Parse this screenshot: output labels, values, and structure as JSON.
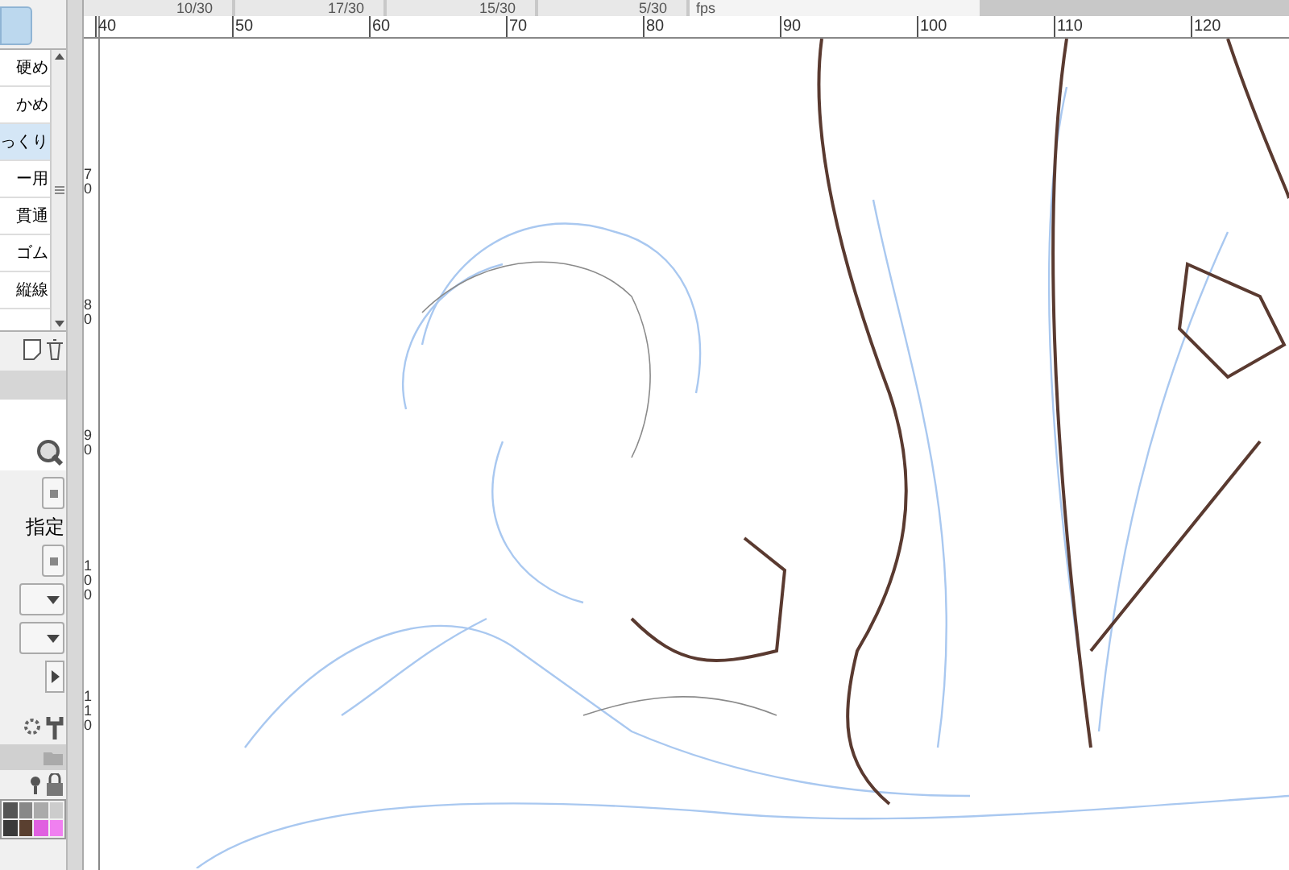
{
  "document_tabs": [
    {
      "label": "10/30",
      "selected": false
    },
    {
      "label": "17/30",
      "selected": false
    },
    {
      "label": "15/30",
      "selected": false
    },
    {
      "label": "5/30",
      "selected": false
    }
  ],
  "frame_rate": {
    "value": "fps"
  },
  "brush_list": {
    "items": [
      {
        "label": "硬め",
        "selected": false
      },
      {
        "label": "かめ",
        "selected": false
      },
      {
        "label": "っくり",
        "selected": true
      },
      {
        "label": "ー用",
        "selected": false
      },
      {
        "label": "貫通",
        "selected": false
      },
      {
        "label": "ゴム",
        "selected": false
      },
      {
        "label": "縦線",
        "selected": false
      }
    ]
  },
  "tool_property": {
    "label": "指定"
  },
  "palette": {
    "swatches": [
      {
        "color": "#555555"
      },
      {
        "color": "#888888"
      },
      {
        "color": "#aaaaaa"
      },
      {
        "color": "#cccccc"
      },
      {
        "color": "#3a3a3a"
      },
      {
        "color": "#5a4030"
      },
      {
        "color": "#e060e0"
      },
      {
        "color": "#f080f0"
      }
    ]
  },
  "ruler": {
    "horizontal": [
      "40",
      "50",
      "60",
      "70",
      "80",
      "90",
      "100",
      "110",
      "120"
    ],
    "vertical": [
      "70",
      "80",
      "90",
      "100",
      "110"
    ]
  }
}
